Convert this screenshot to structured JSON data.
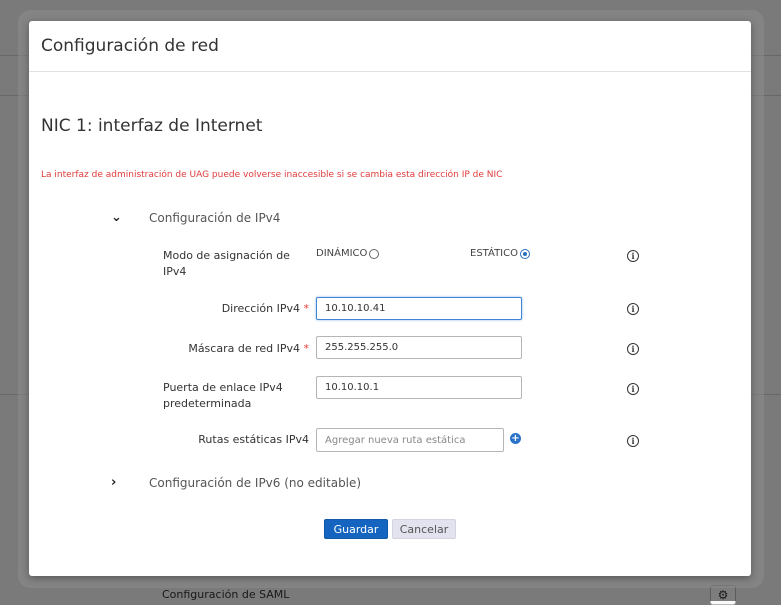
{
  "background": {
    "saml_label": "Configuración de SAML",
    "gear_icon": "gear-icon"
  },
  "modal": {
    "title": "Configuración de red",
    "section_title": "NIC 1: interfaz de Internet",
    "warning": "La interfaz de administración de UAG puede volverse inaccesible si se cambia esta dirección IP de NIC",
    "ipv4_group": {
      "label": "Configuración de IPv4",
      "expanded": true,
      "mode": {
        "label": "Modo de asignación de IPv4",
        "option_dynamic": "DINÁMICO",
        "option_static": "ESTÁTICO",
        "selected": "ESTÁTICO"
      },
      "address": {
        "label": "Dirección IPv4",
        "required_mark": "*",
        "value": "10.10.10.41"
      },
      "mask": {
        "label": "Máscara de red IPv4",
        "required_mark": "*",
        "value": "255.255.255.0"
      },
      "gateway": {
        "label": "Puerta de enlace IPv4 predeterminada",
        "value": "10.10.10.1"
      },
      "routes": {
        "label": "Rutas estáticas IPv4",
        "placeholder": "Agregar nueva ruta estática"
      }
    },
    "ipv6_group": {
      "label": "Configuración de IPv6 (no editable)",
      "expanded": false
    },
    "save_label": "Guardar",
    "cancel_label": "Cancelar"
  },
  "colors": {
    "primary": "#1565c0",
    "warning": "#e03b3b",
    "focus": "#3f86d6"
  }
}
